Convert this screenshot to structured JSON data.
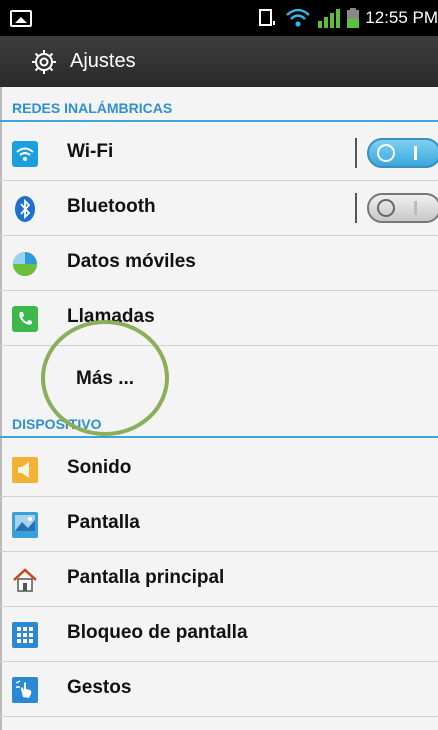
{
  "status_bar": {
    "time": "12:55 PM",
    "icons": [
      "notification-icon",
      "phone-signal-icon",
      "wifi-icon",
      "signal-bars-icon",
      "battery-icon"
    ]
  },
  "action_bar": {
    "title": "Ajustes",
    "icon": "gear-icon"
  },
  "sections": [
    {
      "header": "REDES INALÁMBRICAS",
      "items": [
        {
          "label": "Wi-Fi",
          "icon": "wifi-icon",
          "toggle": "on"
        },
        {
          "label": "Bluetooth",
          "icon": "bluetooth-icon",
          "toggle": "off"
        },
        {
          "label": "Datos móviles",
          "icon": "mobile-data-icon"
        },
        {
          "label": "Llamadas",
          "icon": "phone-icon"
        },
        {
          "label": "Más ..."
        }
      ]
    },
    {
      "header": "DISPOSITIVO",
      "items": [
        {
          "label": "Sonido",
          "icon": "speaker-icon"
        },
        {
          "label": "Pantalla",
          "icon": "display-icon"
        },
        {
          "label": "Pantalla principal",
          "icon": "home-icon"
        },
        {
          "label": "Bloqueo de pantalla",
          "icon": "lock-screen-icon"
        },
        {
          "label": "Gestos",
          "icon": "gesture-icon"
        }
      ]
    }
  ],
  "colors": {
    "accent": "#2f8fd0",
    "toggle_on": "#3aa7dc",
    "highlight_circle": "#8bae5a"
  }
}
